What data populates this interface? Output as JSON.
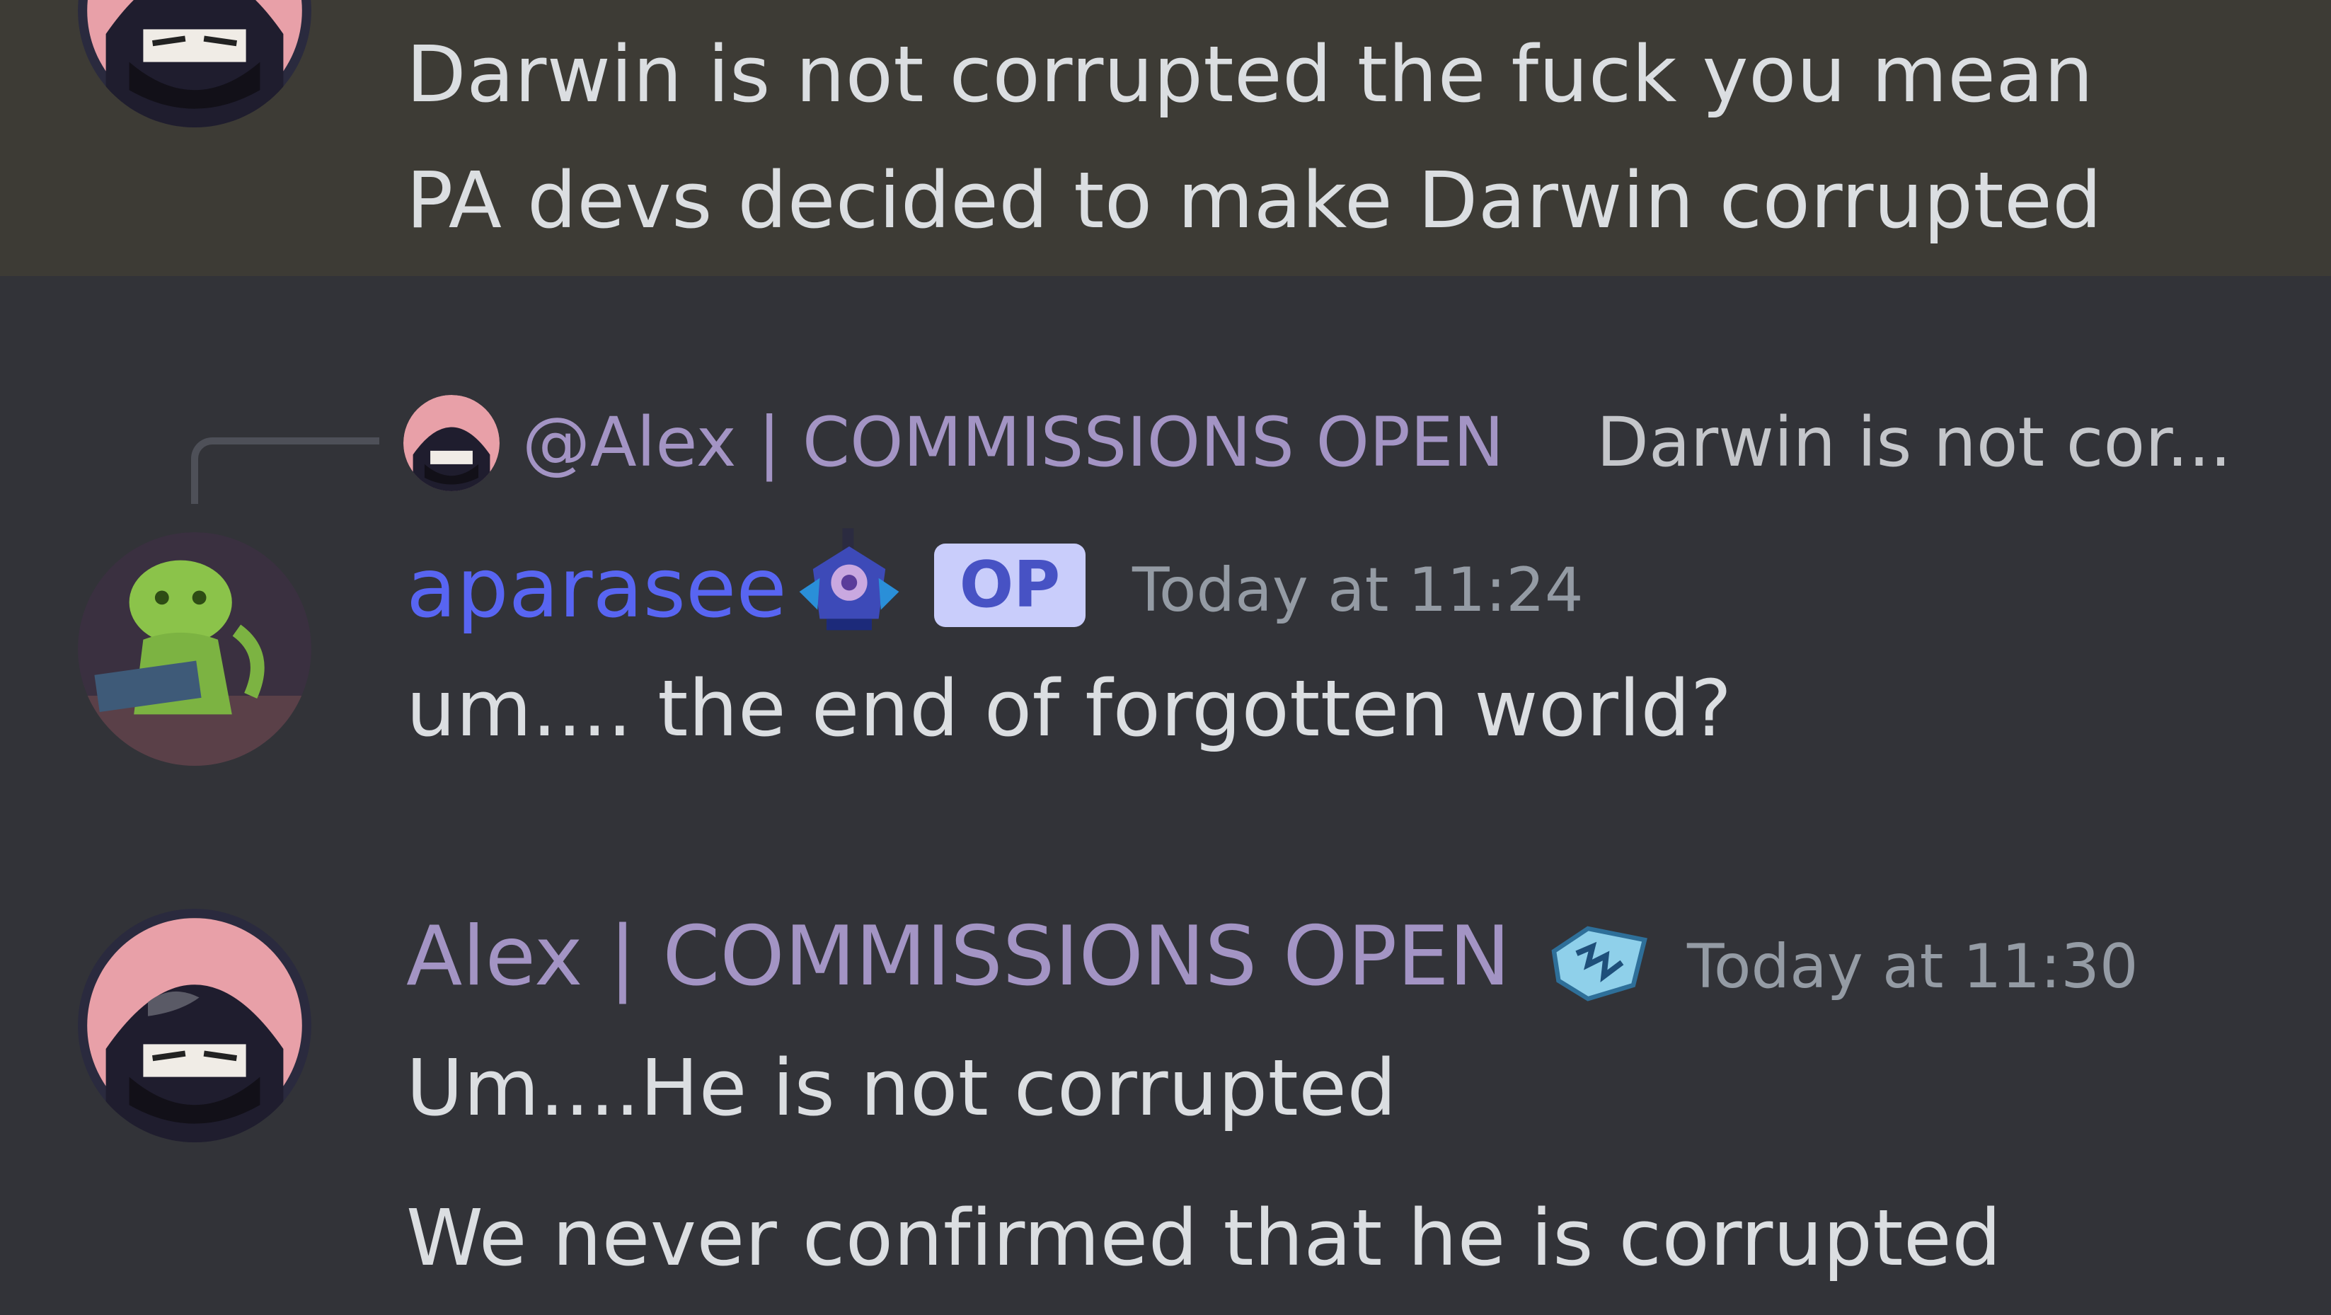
{
  "messages": {
    "first": {
      "lines": [
        "Darwin is not corrupted the fuck you mean",
        "PA devs decided to make Darwin corrupted"
      ]
    },
    "second": {
      "reply": {
        "author": "@Alex | COMMISSIONS OPEN",
        "preview": "Darwin is not cor..."
      },
      "author": "aparasee",
      "author_color": "#5865f2",
      "tag": "OP",
      "timestamp": "Today at 11:24",
      "lines": [
        "um.... the end of forgotten world?"
      ]
    },
    "third": {
      "author": "Alex | COMMISSIONS OPEN",
      "author_color": "#a394c4",
      "timestamp": "Today at 11:30",
      "lines": [
        "Um....He is not corrupted",
        "We never confirmed that he is corrupted"
      ]
    }
  },
  "colors": {
    "background": "#323338",
    "highlight": "#3d3b35",
    "text": "#dbdee1",
    "muted": "#949ba4"
  },
  "icons": {
    "alex_avatar": "hooded-ninja-avatar",
    "aparasee_avatar": "green-creature-reading-avatar",
    "aparasee_badge": "robot-sprite-icon",
    "alex_badge": "blue-scribble-icon"
  }
}
